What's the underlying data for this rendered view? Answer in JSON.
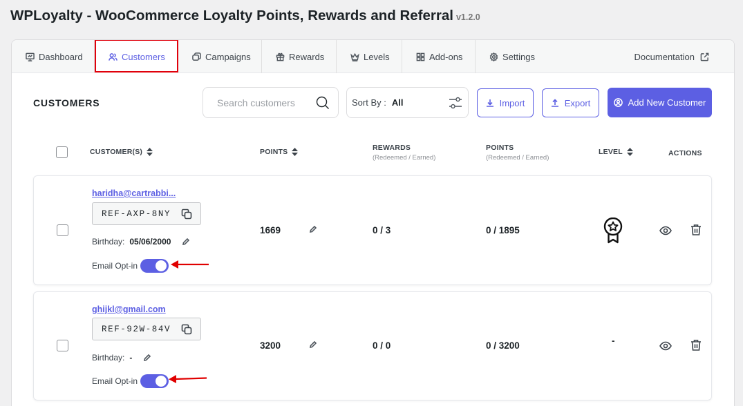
{
  "header": {
    "title": "WPLoyalty - WooCommerce Loyalty Points, Rewards and Referral",
    "version": "v1.2.0"
  },
  "tabs": [
    {
      "label": "Dashboard",
      "icon": "dashboard-icon"
    },
    {
      "label": "Customers",
      "icon": "users-icon"
    },
    {
      "label": "Campaigns",
      "icon": "campaigns-icon"
    },
    {
      "label": "Rewards",
      "icon": "gift-icon"
    },
    {
      "label": "Levels",
      "icon": "crown-icon"
    },
    {
      "label": "Add-ons",
      "icon": "grid-icon"
    },
    {
      "label": "Settings",
      "icon": "gear-icon"
    }
  ],
  "active_tab": "Customers",
  "documentation_label": "Documentation",
  "section_title": "CUSTOMERS",
  "search": {
    "placeholder": "Search customers",
    "value": ""
  },
  "sort": {
    "label": "Sort By :",
    "value": "All"
  },
  "actions": {
    "import_label": "Import",
    "export_label": "Export",
    "add_label": "Add New Customer"
  },
  "table": {
    "headers": {
      "customers": "CUSTOMER(S)",
      "points": "POINTS",
      "rewards": "REWARDS",
      "rewards_sub": "(Redeemed / Earned)",
      "points2": "POINTS",
      "points2_sub": "(Redeemed / Earned)",
      "level": "LEVEL",
      "actions": "ACTIONS"
    },
    "rows": [
      {
        "email": "haridha@cartrabbi...",
        "ref": "REF-AXP-8NY",
        "birthday_label": "Birthday:",
        "birthday": "05/06/2000",
        "optin_label": "Email Opt-in",
        "optin": true,
        "points": "1669",
        "rewards": "0 / 3",
        "points_redeemed_earned": "0 / 1895",
        "level": "badge-icon"
      },
      {
        "email": "ghijkl@gmail.com",
        "ref": "REF-92W-84V",
        "birthday_label": "Birthday:",
        "birthday": "-",
        "optin_label": "Email Opt-in",
        "optin": true,
        "points": "3200",
        "rewards": "0 / 0",
        "points_redeemed_earned": "0 / 3200",
        "level": "-"
      }
    ]
  },
  "colors": {
    "accent": "#5c5fe3",
    "highlight": "#e0000b",
    "annotation_arrow": "#e00000"
  }
}
